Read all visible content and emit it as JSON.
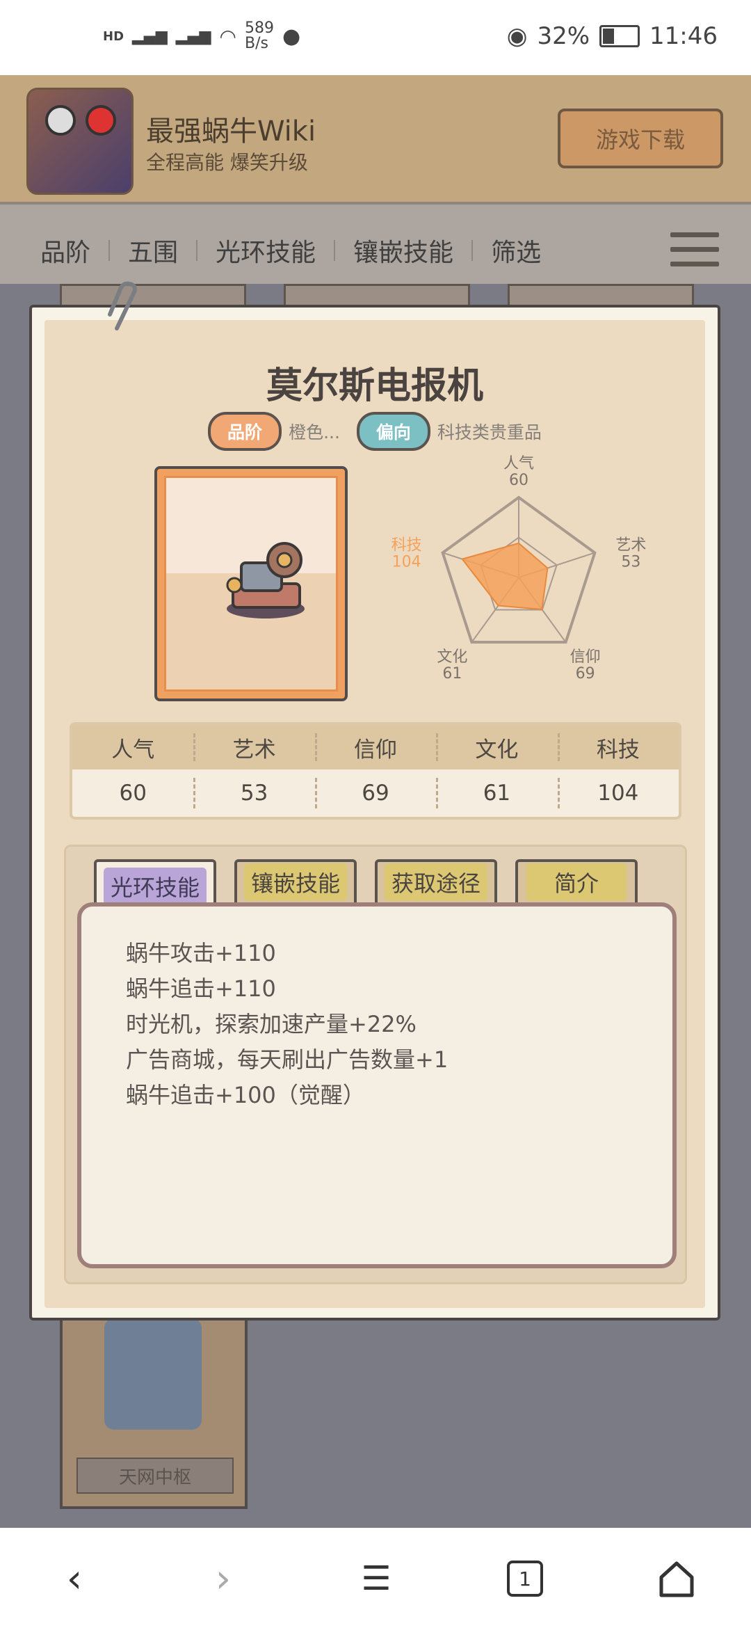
{
  "status_bar": {
    "network_speed_value": "589",
    "network_speed_unit": "B/s",
    "battery": "32%",
    "time": "11:46"
  },
  "header": {
    "app_title": "最强蜗牛Wiki",
    "app_subtitle": "全程高能 爆笑升级",
    "download_button": "游戏下载"
  },
  "nav": {
    "items": [
      "品阶",
      "五围",
      "光环技能",
      "镶嵌技能",
      "筛选"
    ]
  },
  "modal": {
    "title": "莫尔斯电报机",
    "grade_label": "品阶",
    "grade_value": "橙色...",
    "bias_label": "偏向",
    "bias_value": "科技类贵重品",
    "radar": {
      "labels": [
        "人气",
        "艺术",
        "信仰",
        "文化",
        "科技"
      ],
      "values": [
        "60",
        "53",
        "69",
        "61",
        "104"
      ],
      "highlight_color": "#f5a15a"
    },
    "stats": {
      "headers": [
        "人气",
        "艺术",
        "信仰",
        "文化",
        "科技"
      ],
      "values": [
        "60",
        "53",
        "69",
        "61",
        "104"
      ]
    },
    "tabs": [
      "光环技能",
      "镶嵌技能",
      "获取途径",
      "简介"
    ],
    "active_tab": "光环技能",
    "skills": [
      "蜗牛攻击+110",
      "蜗牛追击+110",
      "时光机，探索加速产量+22%",
      "广告商城，每天刷出广告数量+1",
      "蜗牛追击+100（觉醒）"
    ]
  },
  "background": {
    "card_label": "天网中枢"
  },
  "bottom_nav": {
    "tab_count": "1"
  },
  "colors": {
    "header_bg": "#c2a77f",
    "accent_orange": "#f0a061",
    "tab_active": "#b9a5d8"
  }
}
